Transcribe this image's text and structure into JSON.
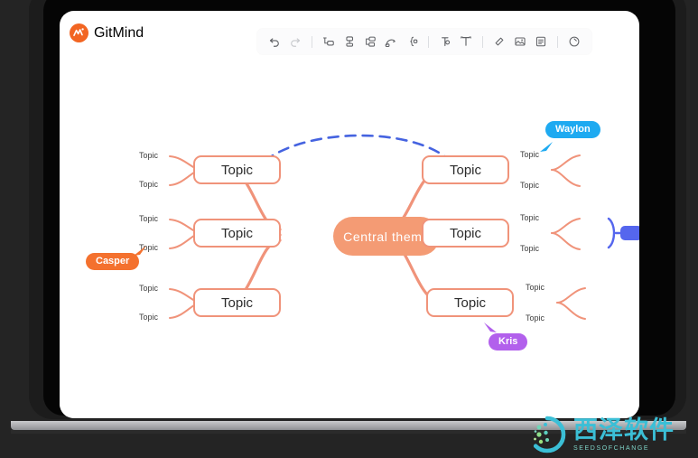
{
  "app": {
    "brand_name": "GitMind",
    "brand_logo_icon": "gitmind-logo-icon",
    "brand_color": "#f26522"
  },
  "toolbar": {
    "items": [
      {
        "name": "undo-icon",
        "label": "Undo",
        "enabled": true
      },
      {
        "name": "redo-icon",
        "label": "Redo",
        "enabled": false
      },
      {
        "name": "separator-1",
        "label": "",
        "enabled": false
      },
      {
        "name": "insert-sibling-node-icon",
        "label": "Insert sibling topic",
        "enabled": true
      },
      {
        "name": "insert-parent-node-icon",
        "label": "Insert parent topic",
        "enabled": true
      },
      {
        "name": "insert-child-node-icon",
        "label": "Insert subtopic",
        "enabled": true
      },
      {
        "name": "insert-relationship-icon",
        "label": "Relationship",
        "enabled": true
      },
      {
        "name": "insert-summary-icon",
        "label": "Summary",
        "enabled": true
      },
      {
        "name": "separator-2",
        "label": "",
        "enabled": false
      },
      {
        "name": "node-style-icon",
        "label": "Node style",
        "enabled": true
      },
      {
        "name": "text-format-icon",
        "label": "Text format",
        "enabled": true
      },
      {
        "name": "separator-3",
        "label": "",
        "enabled": false
      },
      {
        "name": "link-icon",
        "label": "Insert link",
        "enabled": true
      },
      {
        "name": "image-icon",
        "label": "Insert image",
        "enabled": true
      },
      {
        "name": "note-icon",
        "label": "Insert note",
        "enabled": true
      },
      {
        "name": "separator-4",
        "label": "",
        "enabled": false
      },
      {
        "name": "history-icon",
        "label": "History",
        "enabled": true
      }
    ]
  },
  "mindmap": {
    "central": {
      "label": "Central  theme",
      "fill": "#f49b74",
      "text_color": "#ffffff"
    },
    "branch_color": "#f0937a",
    "branches": [
      {
        "id": "branch-top-left",
        "label": "Topic",
        "side": "left",
        "leaves": [
          "Topic",
          "Topic"
        ]
      },
      {
        "id": "branch-middle-left",
        "label": "Topic",
        "side": "left",
        "leaves": [
          "Topic",
          "Topic"
        ]
      },
      {
        "id": "branch-bottom-left",
        "label": "Topic",
        "side": "left",
        "leaves": [
          "Topic",
          "Topic"
        ]
      },
      {
        "id": "branch-top-right",
        "label": "Topic",
        "side": "right",
        "leaves": [
          "Topic",
          "Topic"
        ]
      },
      {
        "id": "branch-middle-right",
        "label": "Topic",
        "side": "right",
        "leaves": [
          "Topic",
          "Topic"
        ]
      },
      {
        "id": "branch-bottom-right",
        "label": "Topic",
        "side": "right",
        "leaves": [
          "Topic",
          "Topic"
        ]
      }
    ],
    "relationship_arrow": {
      "name": "relationship-arrow",
      "style": "dashed",
      "color": "#4563e0"
    },
    "collapsed_branch": {
      "name": "collapsed-branch-indicator",
      "color": "#5566ee"
    }
  },
  "collaborators": [
    {
      "name": "Waylon",
      "color": "#1eaaf1",
      "cursor": "waylon-cursor"
    },
    {
      "name": "Casper",
      "color": "#f4712e",
      "cursor": "casper-cursor"
    },
    {
      "name": "Kris",
      "color": "#b260ec",
      "cursor": "kris-cursor"
    }
  ],
  "watermark": {
    "title": "西泽软件",
    "subtitle": "SEEDSOFCHANGE",
    "color": "#3bbfd6"
  }
}
